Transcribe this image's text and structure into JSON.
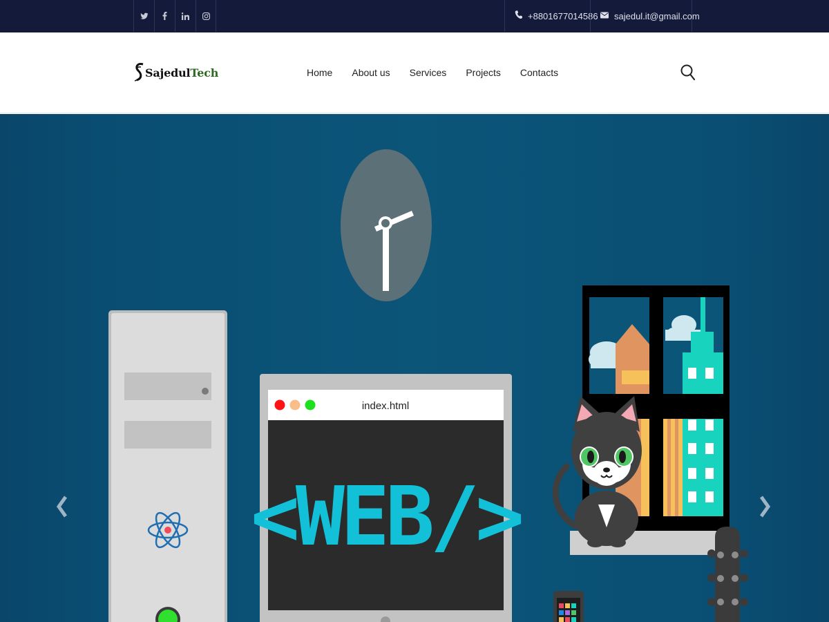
{
  "topbar": {
    "social": [
      {
        "name": "twitter",
        "glyph": "𝕥",
        "icon": "twitter-icon"
      },
      {
        "name": "facebook",
        "glyph": "f",
        "icon": "facebook-icon"
      },
      {
        "name": "linkedin",
        "glyph": "in",
        "icon": "linkedin-icon"
      },
      {
        "name": "instagram",
        "glyph": "◎",
        "icon": "instagram-icon"
      }
    ],
    "phone": "+8801677014586",
    "email": "sajedul.it@gmail.com"
  },
  "header": {
    "logo_main": "Sajedul",
    "logo_accent": "Tech",
    "nav": [
      "Home",
      "About us",
      "Services",
      "Projects",
      "Contacts"
    ]
  },
  "hero": {
    "browser_tab_title": "index.html",
    "code_text": "<WEB/>",
    "colors": {
      "background": "#0b5579",
      "code_text": "#12c1d8",
      "window_frame": "#000000"
    }
  }
}
